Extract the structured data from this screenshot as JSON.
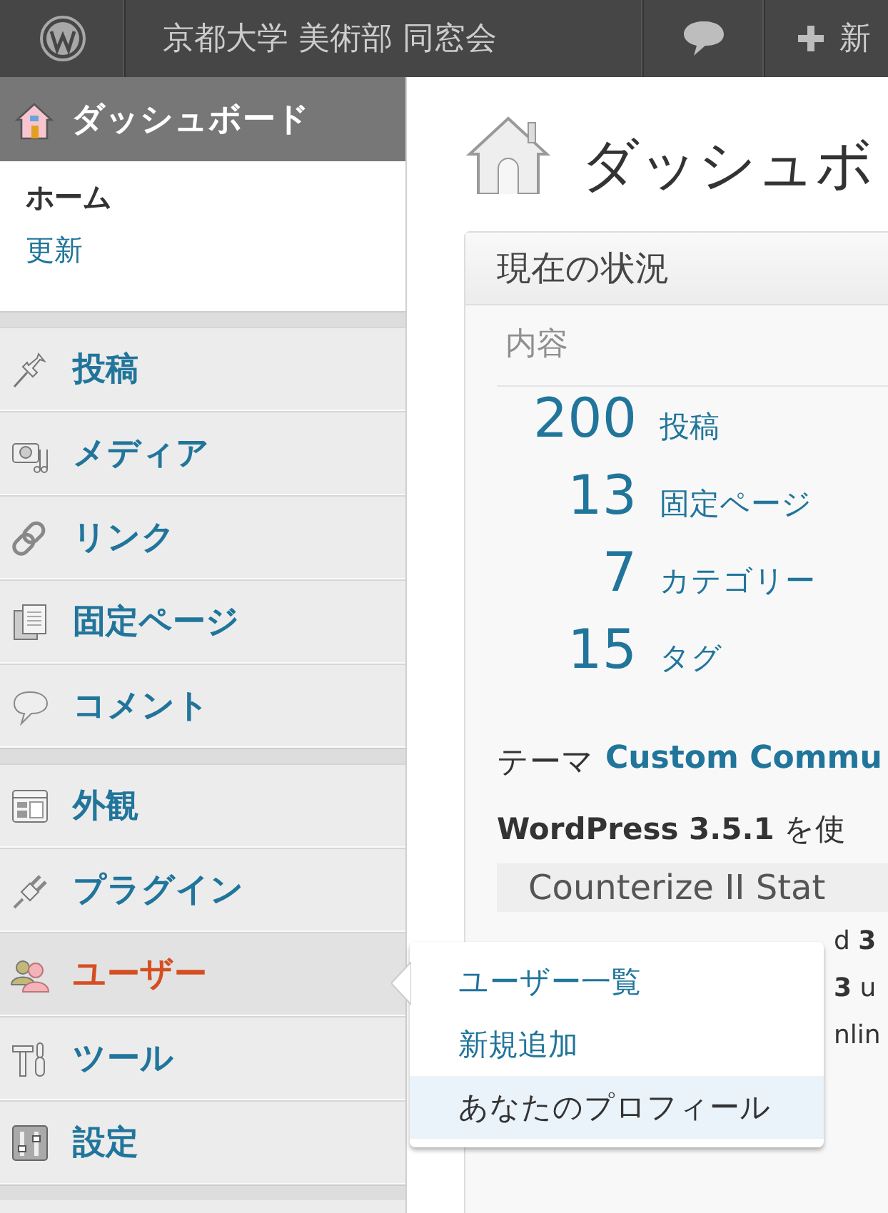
{
  "top_bar": {
    "site_name": "京都大学 美術部 同窓会",
    "new_label": "新"
  },
  "sidebar": {
    "header": {
      "label": "ダッシュボード",
      "selected": true
    },
    "submenu": [
      {
        "label": "ホーム",
        "selected": true
      },
      {
        "label": "更新",
        "selected": false
      }
    ],
    "groups": [
      [
        {
          "label": "投稿",
          "selected": false
        },
        {
          "label": "メディア",
          "selected": false
        },
        {
          "label": "リンク",
          "selected": false
        },
        {
          "label": "固定ページ",
          "selected": false
        },
        {
          "label": "コメント",
          "selected": false
        }
      ],
      [
        {
          "label": "外観",
          "selected": false
        },
        {
          "label": "プラグイン",
          "selected": false
        },
        {
          "label": "ユーザー",
          "selected": true
        },
        {
          "label": "ツール",
          "selected": false
        },
        {
          "label": "設定",
          "selected": false
        }
      ]
    ]
  },
  "flyout": [
    {
      "label": "ユーザー一覧",
      "selected": false
    },
    {
      "label": "新規追加",
      "selected": false
    },
    {
      "label": "あなたのプロフィール",
      "selected": true
    }
  ],
  "page_title": "ダッシュボ",
  "status_box": {
    "title": "現在の状況",
    "section": "内容",
    "rows": [
      {
        "count": "200",
        "label": "投稿"
      },
      {
        "count": "13",
        "label": "固定ページ"
      },
      {
        "count": "7",
        "label": "カテゴリー"
      },
      {
        "count": "15",
        "label": "タグ"
      }
    ],
    "theme_label": "テーマ",
    "theme_link": "Custom Commu",
    "version_text": "**WordPress 3.5.1** を使",
    "plugin_bar": "Counterize II Stat",
    "fragments": [
      "d **3**",
      "**3** u",
      "nlin"
    ]
  }
}
